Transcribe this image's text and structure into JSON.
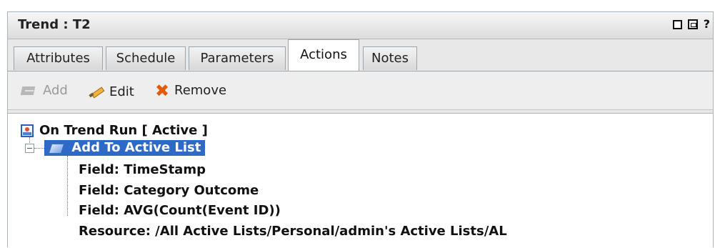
{
  "window": {
    "title": "Trend : T2",
    "controls": {
      "help": "?"
    }
  },
  "tabs": [
    {
      "label": "Attributes",
      "active": false
    },
    {
      "label": "Schedule",
      "active": false
    },
    {
      "label": "Parameters",
      "active": false
    },
    {
      "label": "Actions",
      "active": true
    },
    {
      "label": "Notes",
      "active": false
    }
  ],
  "toolbar": {
    "add_label": "Add",
    "edit_label": "Edit",
    "remove_label": "Remove"
  },
  "tree": {
    "root": "On Trend Run [ Active ]",
    "action": "Add To Active List",
    "children": [
      "Field: TimeStamp",
      "Field: Category Outcome",
      "Field: AVG(Count(Event ID))",
      "Resource: /All Active Lists/Personal/admin's Active Lists/AL"
    ]
  },
  "colors": {
    "selection": "#2f69c7",
    "remove_icon": "#e15b09"
  }
}
